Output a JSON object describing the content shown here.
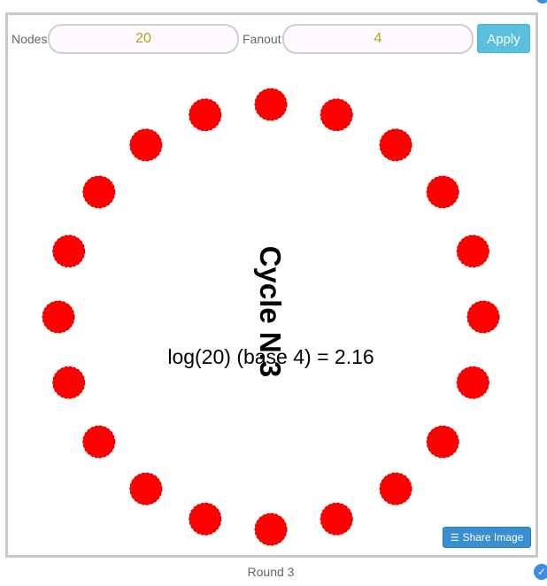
{
  "controls": {
    "nodes_label": "Nodes",
    "nodes_value": "20",
    "fanout_label": "Fanout",
    "fanout_value": "4",
    "apply_label": "Apply"
  },
  "graph": {
    "node_count": 20,
    "node_color": "#ff0000",
    "cycle_label": "Cycle N.3",
    "formula": "log(20) (base 4) = 2.16"
  },
  "share_button": {
    "label": "Share Image",
    "icon": "layers-icon"
  },
  "footer": {
    "round_label": "Round 3"
  },
  "colors": {
    "accent": "#5bc0de",
    "share": "#3a8fd0",
    "value_text": "#b5a31d"
  }
}
